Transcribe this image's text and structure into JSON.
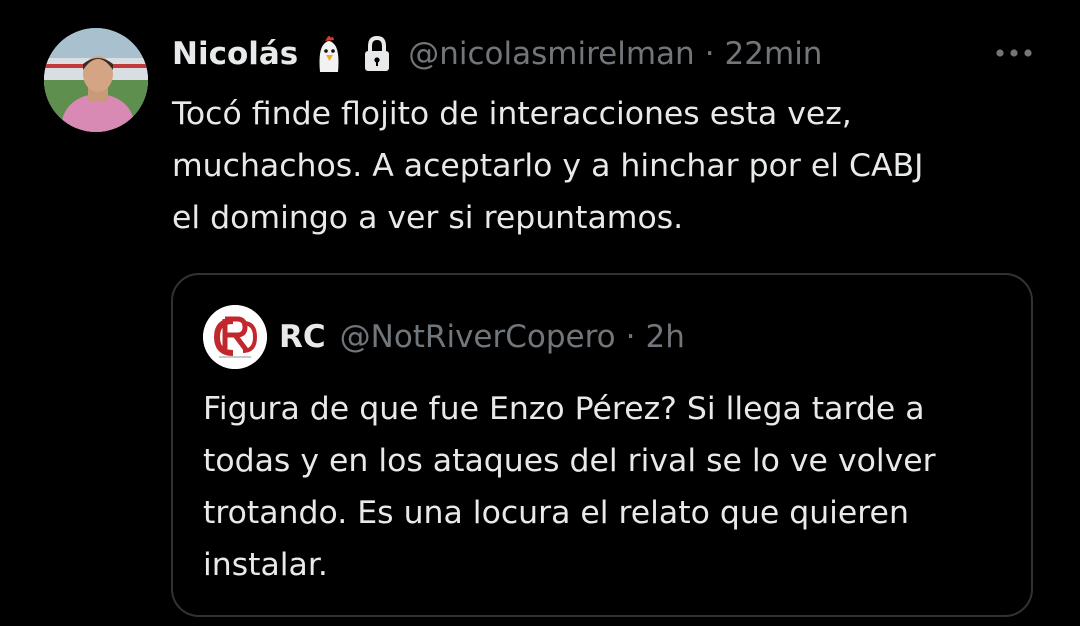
{
  "tweet": {
    "author_name": "Nicolás",
    "author_handle": "@nicolasmirelman",
    "separator": "·",
    "time": "22min",
    "emoji_icon": "ghost-chicken-emoji-icon",
    "lock_icon": "lock-icon",
    "more_icon": "more-options-icon",
    "text": "Tocó finde flojito de interacciones esta vez,\nmuchachos. A aceptarlo y a hinchar por el CABJ\nel domingo a ver si repuntamos."
  },
  "quoted_tweet": {
    "author_name": "RC",
    "author_handle": "@NotRiverCopero",
    "separator": "·",
    "time": "2h",
    "avatar_logo_text": "RC",
    "text": "Figura de que fue Enzo Pérez? Si llega tarde a\ntodas y en los ataques del rival se lo ve volver\ntrotando. Es una locura el relato que quieren\ninstalar."
  },
  "colors": {
    "background": "#000000",
    "primary_text": "#e7e9ea",
    "secondary_text": "#71767b",
    "border": "#2f3336",
    "logo_red": "#c0282d"
  }
}
